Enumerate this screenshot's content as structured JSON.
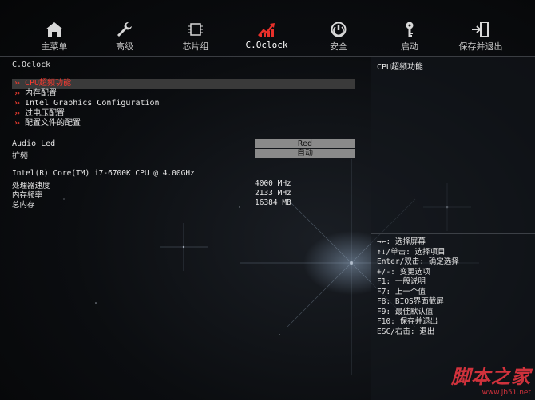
{
  "nav": {
    "items": [
      {
        "label": "主菜单",
        "icon": "home-icon"
      },
      {
        "label": "高级",
        "icon": "wrench-icon"
      },
      {
        "label": "芯片组",
        "icon": "chip-icon"
      },
      {
        "label": "C.Oclock",
        "icon": "overclock-chart-icon",
        "active": true
      },
      {
        "label": "安全",
        "icon": "shield-lock-icon"
      },
      {
        "label": "启动",
        "icon": "key-icon"
      },
      {
        "label": "保存并退出",
        "icon": "exit-door-icon"
      }
    ],
    "active_color": "#e8302a"
  },
  "page": {
    "title": "C.Oclock"
  },
  "menu": {
    "items": [
      {
        "label": "CPU超频功能",
        "selected": true
      },
      {
        "label": "内存配置"
      },
      {
        "label": "Intel Graphics Configuration"
      },
      {
        "label": "过电压配置"
      },
      {
        "label": "配置文件的配置"
      }
    ]
  },
  "settings": [
    {
      "label": "Audio Led",
      "value": "Red"
    },
    {
      "label": "扩频",
      "value": "自动"
    }
  ],
  "system_info": {
    "cpu": "Intel(R) Core(TM) i7-6700K CPU @ 4.00GHz",
    "rows": [
      {
        "label": "处理器速度",
        "value": "4000 MHz"
      },
      {
        "label": "内存频率",
        "value": "2133 MHz"
      },
      {
        "label": "总内存",
        "value": "16384 MB"
      }
    ]
  },
  "help_panel": {
    "description": "CPU超频功能",
    "keys": [
      "→←: 选择屏幕",
      "↑↓/单击: 选择项目",
      "Enter/双击: 确定选择",
      "+/-: 变更选项",
      "F1: 一般说明",
      "F7: 上一个值",
      "F8: BIOS界面截屏",
      "F9: 最佳默认值",
      "F10: 保存并退出",
      "ESC/右击: 退出"
    ]
  },
  "watermark": {
    "title": "脚本之家",
    "url": "www.jb51.net"
  },
  "colors": {
    "accent_red": "#e8302a",
    "value_box": "#8a8a8a",
    "selection_bg": "#3a3a3a"
  }
}
